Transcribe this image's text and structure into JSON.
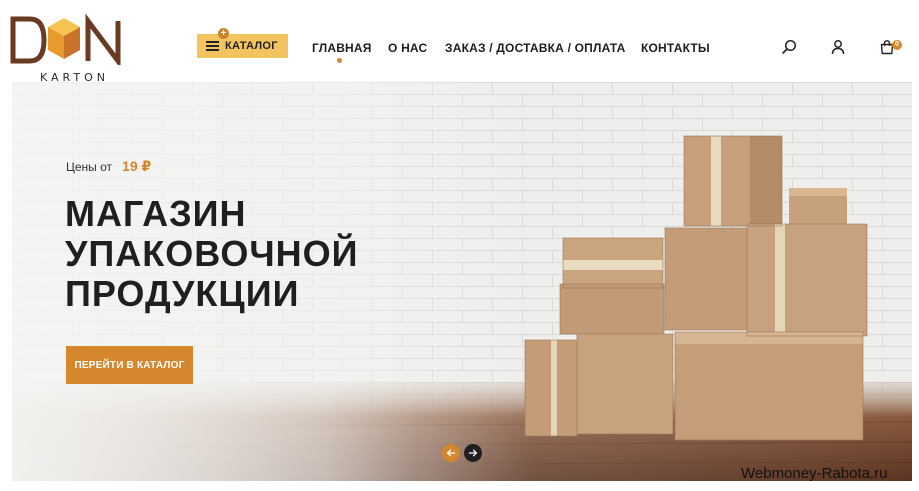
{
  "brand": {
    "logo_text": "KARTON",
    "accent_color": "#d4872c",
    "catalog_color": "#f2c35f"
  },
  "header": {
    "catalog_label": "КАТАЛОГ",
    "catalog_icon": "burger-menu-icon",
    "nav": [
      {
        "label": "ГЛАВНАЯ",
        "active": true
      },
      {
        "label": "О НАС"
      },
      {
        "label": "ЗАКАЗ / ДОСТАВКА / ОПЛАТА"
      },
      {
        "label": "КОНТАКТЫ"
      }
    ],
    "icons": [
      "search-icon",
      "user-icon",
      "cart-icon"
    ],
    "cart_count": "0"
  },
  "hero": {
    "price_prefix": "Цены от",
    "price_value": "19 ₽",
    "title_lines": [
      "МАГАЗИН",
      "УПАКОВОЧНОЙ",
      "ПРОДУКЦИИ"
    ],
    "cta_label": "ПЕРЕЙТИ В КАТАЛОГ",
    "slider_icons": [
      "arrow-left-icon",
      "arrow-right-icon"
    ]
  },
  "watermark": "Webmoney-Rabota.ru"
}
